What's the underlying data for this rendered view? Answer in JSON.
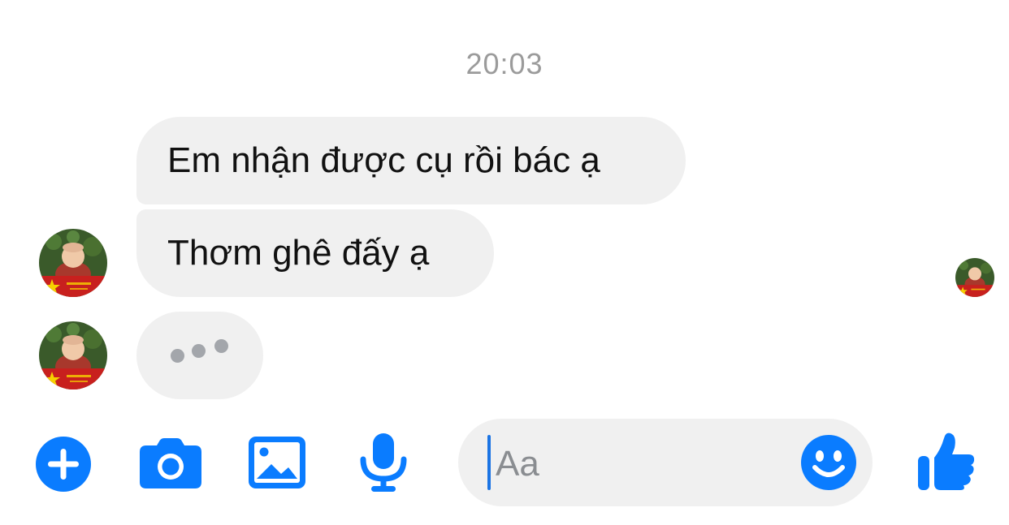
{
  "conversation": {
    "timestamp": "20:03",
    "messages": [
      {
        "text": "Em nhận được cụ rồi bác ạ"
      },
      {
        "text": "Thơm ghê đấy ạ"
      }
    ],
    "typing_indicator": true
  },
  "composer": {
    "placeholder": "Aa"
  },
  "toolbar": {
    "icons": [
      "plus-icon",
      "camera-icon",
      "gallery-icon",
      "microphone-icon",
      "emoji-icon",
      "thumbs-up-icon"
    ]
  },
  "colors": {
    "accent": "#0a7cff",
    "bubble": "#f0f0f0",
    "timestamp": "#9b9b9b",
    "placeholder": "#8a8d91"
  }
}
